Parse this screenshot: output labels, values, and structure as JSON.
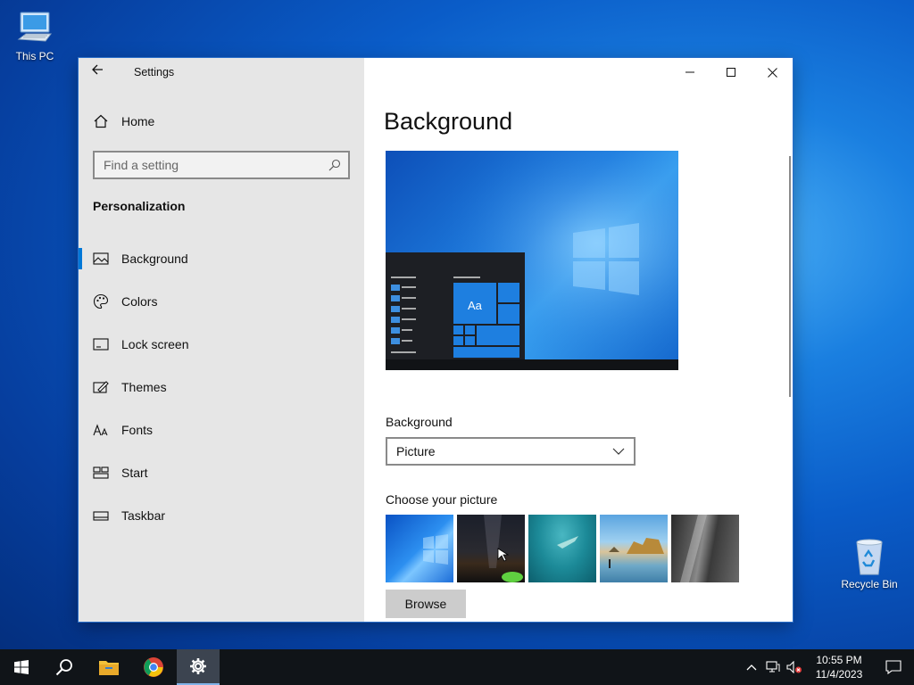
{
  "desktop": {
    "icons": [
      {
        "label": "This PC"
      },
      {
        "label": "Recycle Bin"
      }
    ]
  },
  "window": {
    "app_title": "Settings",
    "sidebar": {
      "home_label": "Home",
      "search_placeholder": "Find a setting",
      "section_title": "Personalization",
      "items": [
        {
          "label": "Background",
          "icon": "picture-icon",
          "active": true
        },
        {
          "label": "Colors",
          "icon": "palette-icon",
          "active": false
        },
        {
          "label": "Lock screen",
          "icon": "lock-screen-icon",
          "active": false
        },
        {
          "label": "Themes",
          "icon": "themes-icon",
          "active": false
        },
        {
          "label": "Fonts",
          "icon": "fonts-icon",
          "active": false
        },
        {
          "label": "Start",
          "icon": "start-icon",
          "active": false
        },
        {
          "label": "Taskbar",
          "icon": "taskbar-icon",
          "active": false
        }
      ]
    },
    "content": {
      "page_title": "Background",
      "preview_tile_text": "Aa",
      "background_label": "Background",
      "background_value": "Picture",
      "choose_picture_label": "Choose your picture",
      "thumbnails": [
        "windows-blue",
        "night-sky",
        "underwater",
        "beach-rocks",
        "rock-cliff"
      ],
      "browse_label": "Browse"
    }
  },
  "taskbar": {
    "buttons": [
      "start-icon",
      "search-icon",
      "file-explorer-icon",
      "chrome-icon",
      "settings-icon"
    ],
    "active_button": "settings-icon",
    "time": "10:55 PM",
    "date": "11/4/2023"
  },
  "colors": {
    "accent": "#0078d7",
    "sidebar_bg": "#e6e6e6",
    "taskbar_bg": "#101418"
  }
}
